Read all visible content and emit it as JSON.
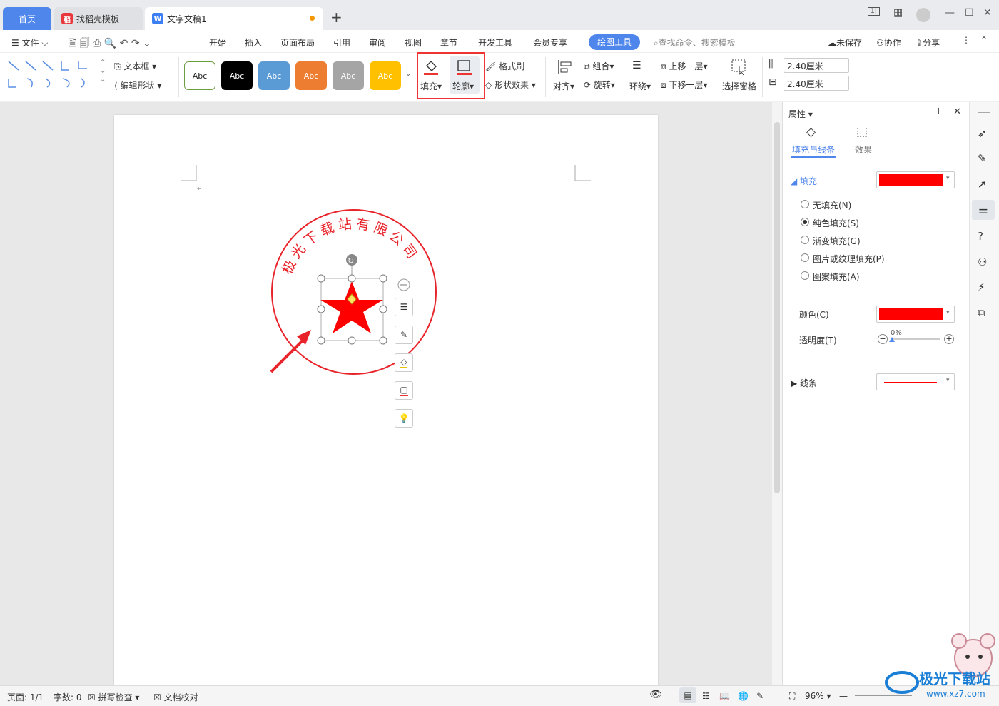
{
  "tabs": {
    "home": "首页",
    "template": "找稻壳模板",
    "doc": "文字文稿1"
  },
  "menu": {
    "file": "文件",
    "items": [
      "开始",
      "插入",
      "页面布局",
      "引用",
      "审阅",
      "视图",
      "章节",
      "开发工具",
      "会员专享"
    ],
    "draw_tools": "绘图工具",
    "search_placeholder": "查找命令、搜索模板",
    "unsaved": "未保存",
    "collab": "协作",
    "share": "分享"
  },
  "ribbon": {
    "textbox": "文本框",
    "edit_shape": "编辑形状",
    "style_label": "Abc",
    "fill": "填充",
    "outline": "轮廓",
    "format_painter": "格式刷",
    "shape_effect": "形状效果",
    "align": "对齐",
    "group": "组合",
    "rotate": "旋转",
    "wrap": "环绕",
    "move_up": "上移一层",
    "move_down": "下移一层",
    "select_pane": "选择窗格",
    "height": "2.40厘米",
    "width": "2.40厘米"
  },
  "stamp_text": "极光下载站有限公司",
  "panel": {
    "title": "属性",
    "tab_fill": "填充与线条",
    "tab_effect": "效果",
    "fill": "填充",
    "options": [
      "无填充(N)",
      "纯色填充(S)",
      "渐变填充(G)",
      "图片或纹理填充(P)",
      "图案填充(A)"
    ],
    "color": "颜色(C)",
    "transparency": "透明度(T)",
    "transparency_value": "0%",
    "line": "线条"
  },
  "colors": {
    "accent": "#4f86ec",
    "fill": "#ff0000",
    "highlight": "#e33333"
  },
  "status": {
    "page": "页面: 1/1",
    "words": "字数: 0",
    "spell": "拼写检查",
    "proof": "文档校对",
    "zoom": "96%"
  },
  "watermark": {
    "text": "极光下载站",
    "url": "www.xz7.com"
  }
}
